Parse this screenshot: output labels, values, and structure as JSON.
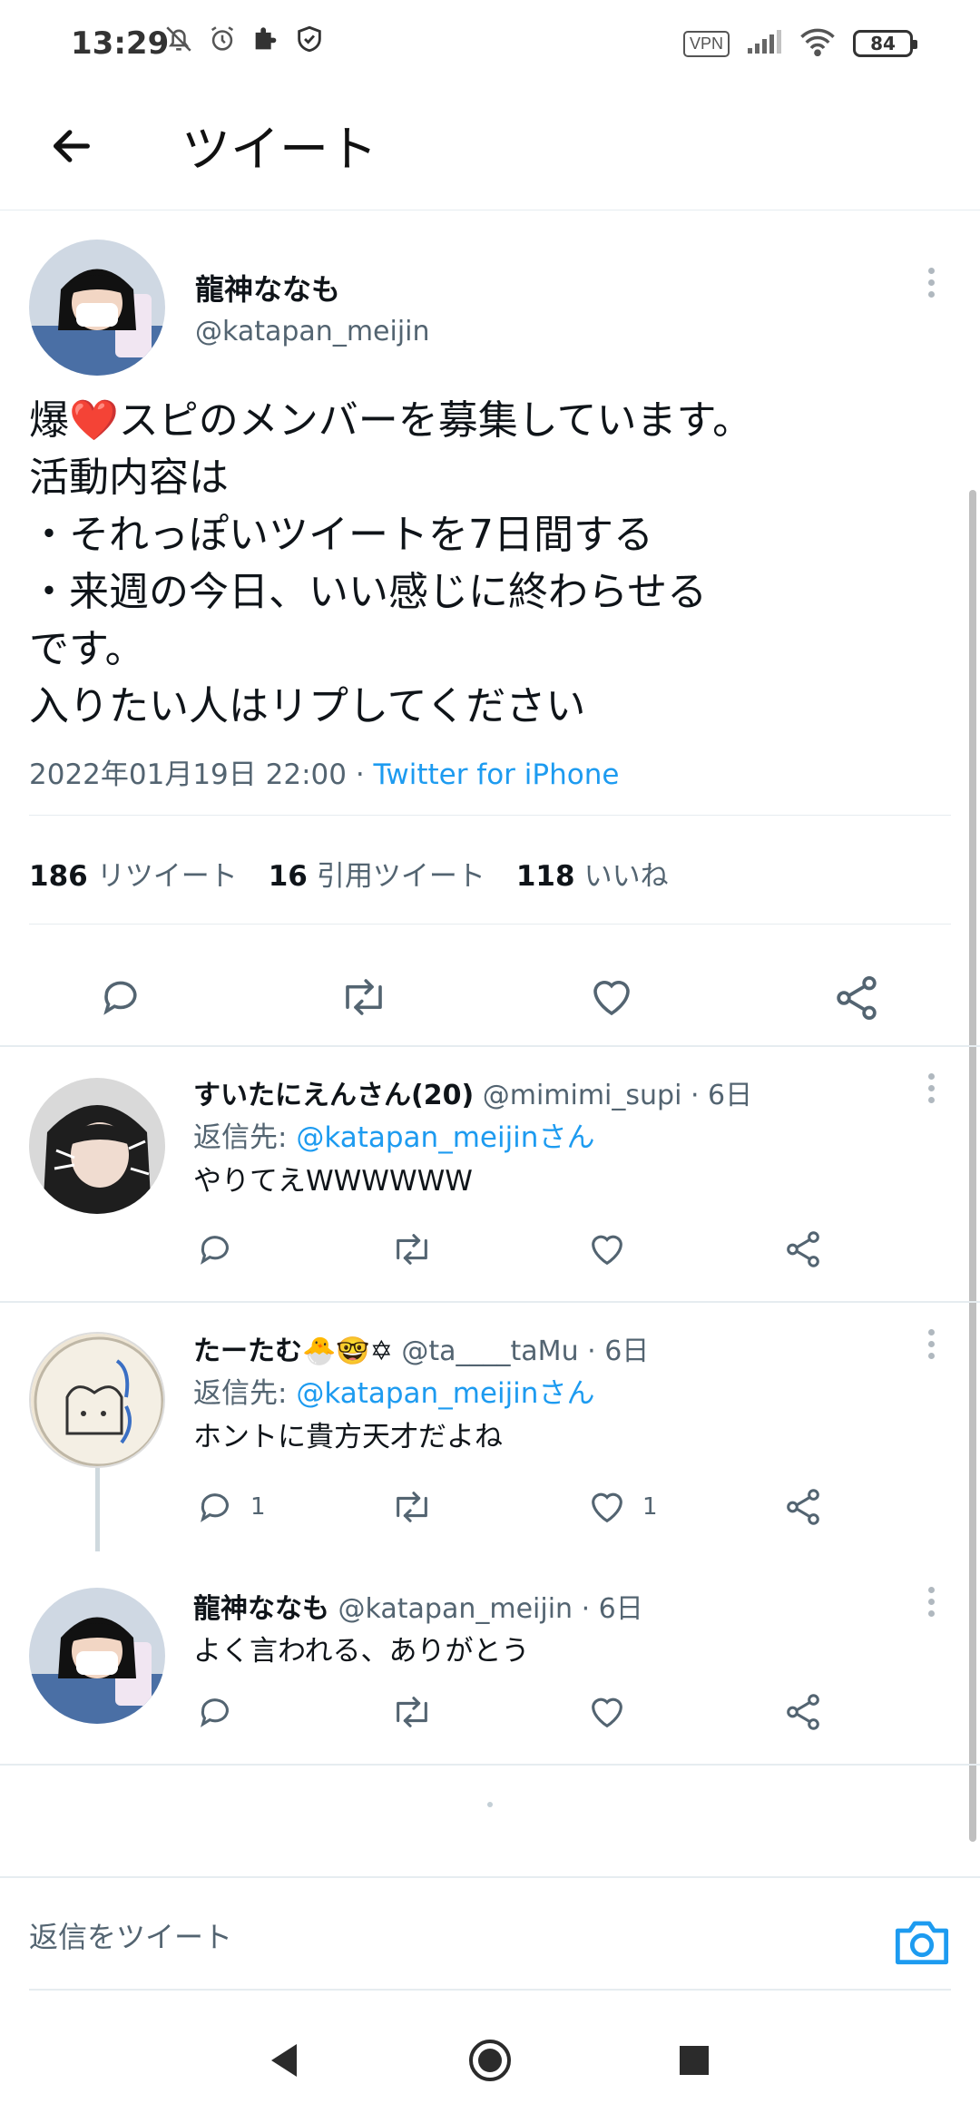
{
  "status_bar": {
    "time": "13:29",
    "vpn": "VPN",
    "battery": "84",
    "left_icons": [
      "mute-bell-icon",
      "alarm-icon",
      "puzzle-icon",
      "shield-check-icon"
    ],
    "right_icons": [
      "signal-icon",
      "wifi-icon"
    ]
  },
  "header": {
    "title": "ツイート"
  },
  "main_tweet": {
    "name": "龍神ななも",
    "handle": "@katapan_meijin",
    "text": "爆❤️スピのメンバーを募集しています。\n活動内容は\n・それっぽいツイートを7日間する\n・来週の今日、いい感じに終わらせる\nです。\n入りたい人はリプしてください",
    "timestamp": "2022年01月19日 22:00",
    "separator": " · ",
    "source": "Twitter for iPhone",
    "stats": {
      "retweets_count": "186",
      "retweets_label": "リツイート",
      "quotes_count": "16",
      "quotes_label": "引用ツイート",
      "likes_count": "118",
      "likes_label": "いいね"
    }
  },
  "replies": [
    {
      "name": "すいたにえんさん(20)",
      "handle": "@mimimi_supi",
      "time": "· 6日",
      "reply_to_label": "返信先: ",
      "reply_to_link": "@katapan_meijinさん",
      "text": "やりてえWWWWWW",
      "reply_count": "",
      "like_count": ""
    },
    {
      "name": "たーたむ🐣🤓✡",
      "handle": "@ta____taMu",
      "time": "· 6日",
      "reply_to_label": "返信先: ",
      "reply_to_link": "@katapan_meijinさん",
      "text": "ホントに貴方天才だよね",
      "reply_count": "1",
      "like_count": "1"
    },
    {
      "name": "龍神ななも",
      "handle": "@katapan_meijin",
      "time": "· 6日",
      "text": "よく言われる、ありがとう",
      "reply_count": "",
      "like_count": ""
    }
  ],
  "compose": {
    "placeholder": "返信をツイート"
  },
  "colors": {
    "link": "#1d9bf0",
    "secondary_text": "#536471",
    "divider": "#e6ecf0"
  }
}
